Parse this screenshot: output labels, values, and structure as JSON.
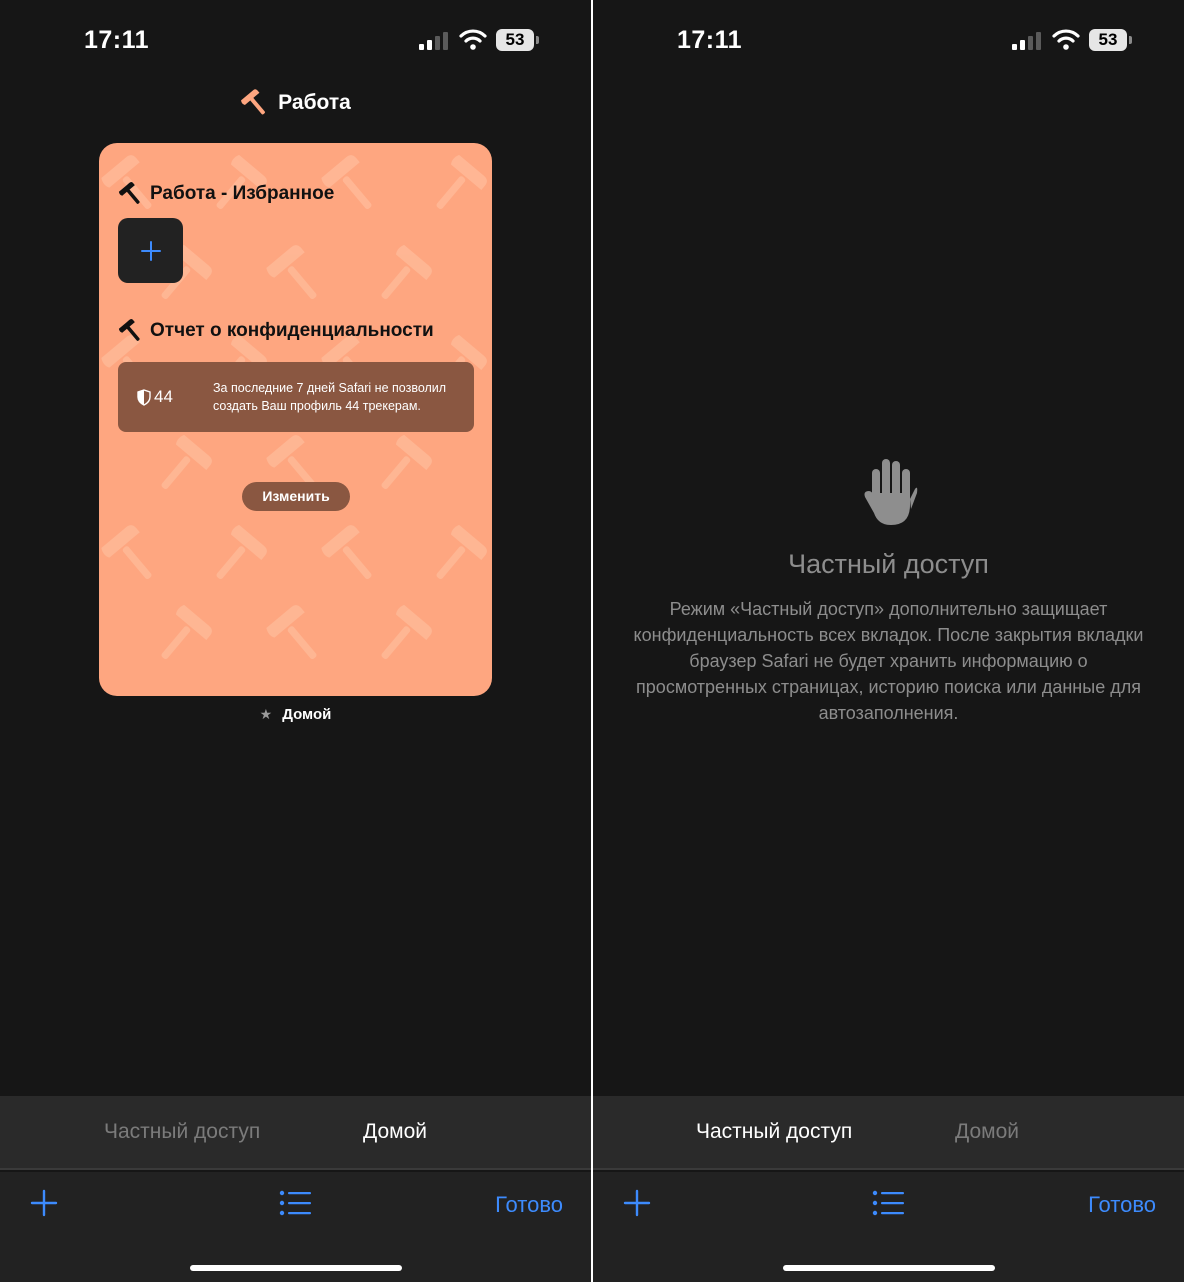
{
  "status_bar": {
    "time": "17:11",
    "battery": "53"
  },
  "left_screen": {
    "group_title": "Работа",
    "card": {
      "favorites_title": "Работа - Избранное",
      "privacy_title": "Отчет о конфиденциальности",
      "tracker_count": "44",
      "report_line1": "За последние 7 дней Safari не позволил",
      "report_line2": "создать Ваш профиль 44 трекерам.",
      "edit_label": "Изменить"
    },
    "card_label": "Домой"
  },
  "right_screen": {
    "heading": "Частный доступ",
    "description": "Режим «Частный доступ» дополнительно защищает конфиденциальность всех вкладок. После закрытия вкладки браузер Safari не будет хранить информацию о просмотренных страницах, историю поиска или данные для автозаполнения."
  },
  "segments": {
    "private": "Частный доступ",
    "home": "Домой"
  },
  "toolbar": {
    "done_label": "Готово"
  },
  "colors": {
    "card_bg": "#fea680",
    "accent": "#3d8bfd",
    "report_bg": "#8a5741"
  },
  "icons": {
    "group": "hammer-icon",
    "add": "plus-icon",
    "shield": "shield-icon",
    "private": "hand-icon",
    "tabs": "list-icon"
  }
}
